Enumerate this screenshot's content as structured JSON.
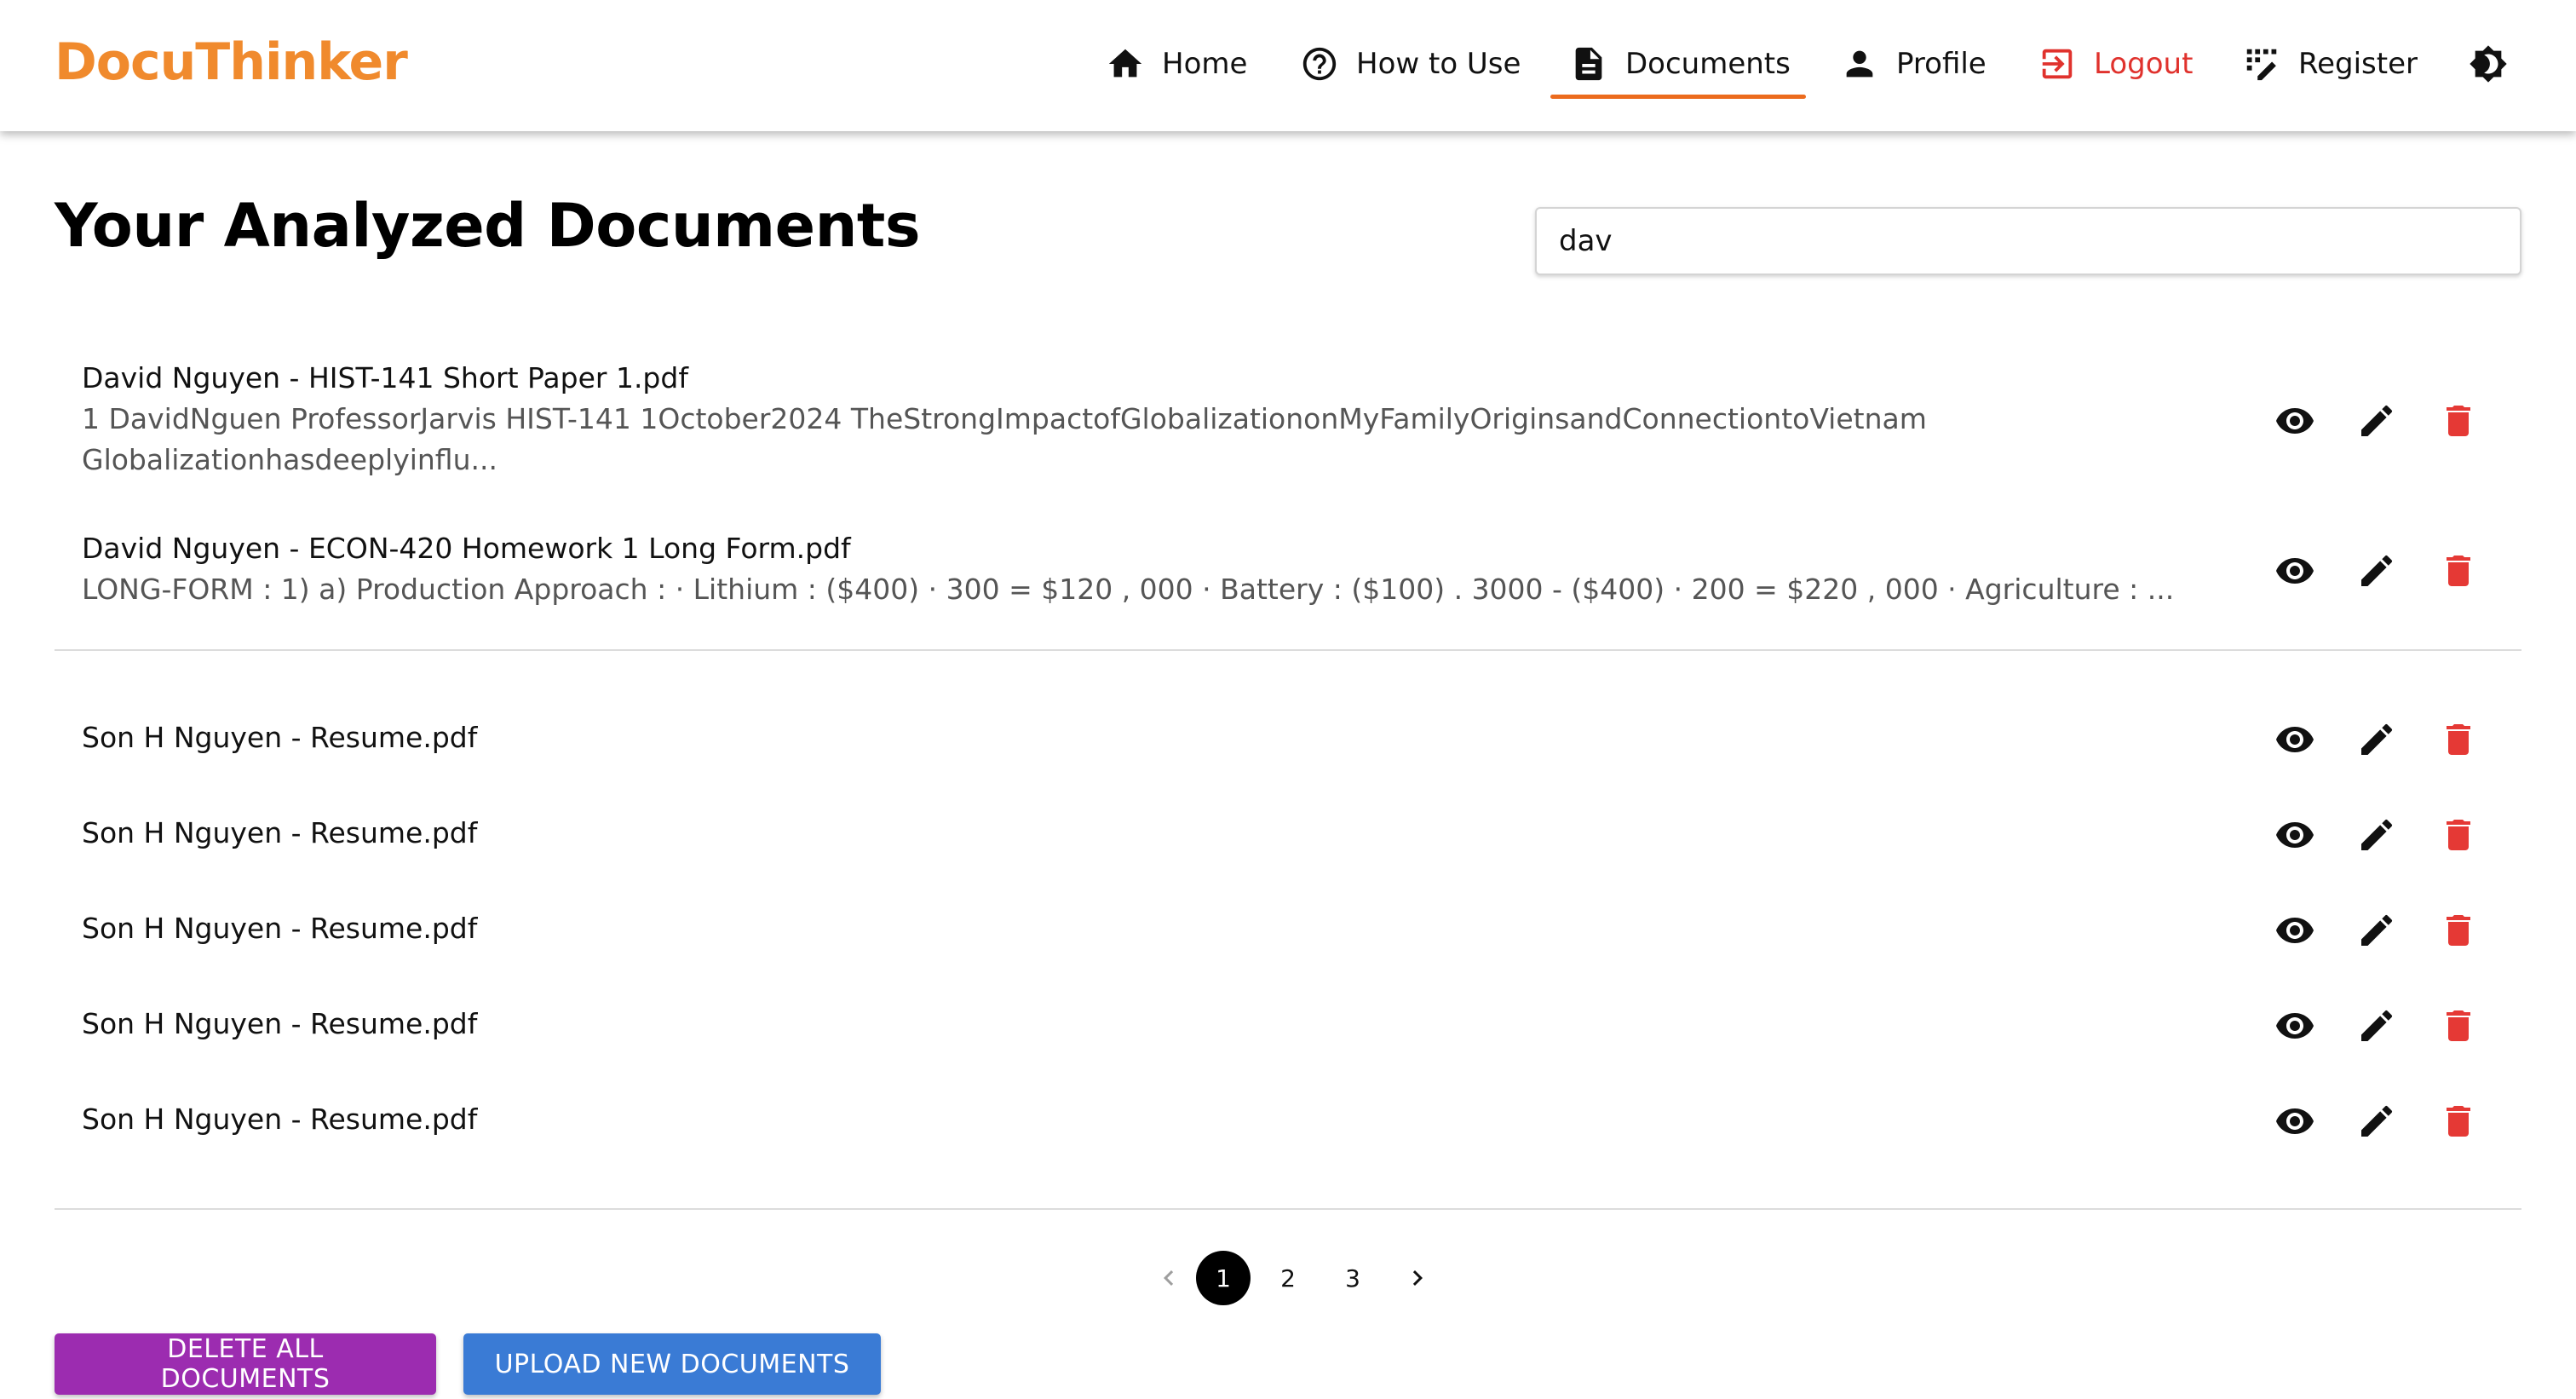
{
  "brand": {
    "name": "DocuThinker",
    "color": "#f08a2d"
  },
  "nav": {
    "items": [
      {
        "label": "Home",
        "icon": "home-icon"
      },
      {
        "label": "How to Use",
        "icon": "help-circle-icon"
      },
      {
        "label": "Documents",
        "icon": "document-icon",
        "active": true
      },
      {
        "label": "Profile",
        "icon": "person-icon"
      },
      {
        "label": "Logout",
        "icon": "logout-icon",
        "color": "#e0322d"
      },
      {
        "label": "Register",
        "icon": "register-icon"
      }
    ],
    "theme_toggle_icon": "brightness-icon",
    "active_underline_color": "#ec6b1d"
  },
  "page": {
    "title": "Your Analyzed Documents",
    "search_value": "dav"
  },
  "documents": [
    {
      "title": "David Nguyen - HIST-141 Short Paper 1.pdf",
      "snippet": "1 DavidNguen ProfessorJarvis HIST-141 1October2024 TheStrongImpactofGlobalizationonMyFamilyOriginsandConnectiontoVietnam Globalizationhasdeeplyinflu..."
    },
    {
      "title": "David Nguyen - ECON-420 Homework 1 Long Form.pdf",
      "snippet": "LONG-FORM : 1) a) Production Approach : · Lithium : ($400) · 300 = $120 , 000 · Battery : ($100) . 3000 - ($400) · 200 = $220 , 000 · Agriculture : ..."
    },
    {
      "title": "Son H Nguyen - Resume.pdf",
      "snippet": ""
    },
    {
      "title": "Son H Nguyen - Resume.pdf",
      "snippet": ""
    },
    {
      "title": "Son H Nguyen - Resume.pdf",
      "snippet": ""
    },
    {
      "title": "Son H Nguyen - Resume.pdf",
      "snippet": ""
    },
    {
      "title": "Son H Nguyen - Resume.pdf",
      "snippet": ""
    }
  ],
  "row_actions": {
    "view_icon": "eye-icon",
    "edit_icon": "pencil-icon",
    "delete_icon": "trash-icon",
    "delete_color": "#e53935"
  },
  "pagination": {
    "pages": [
      "1",
      "2",
      "3"
    ],
    "current": "1"
  },
  "buttons": {
    "delete_all": "DELETE ALL DOCUMENTS",
    "upload": "UPLOAD NEW DOCUMENTS",
    "delete_all_color": "#9c2cb0",
    "upload_color": "#3a7bd5"
  }
}
